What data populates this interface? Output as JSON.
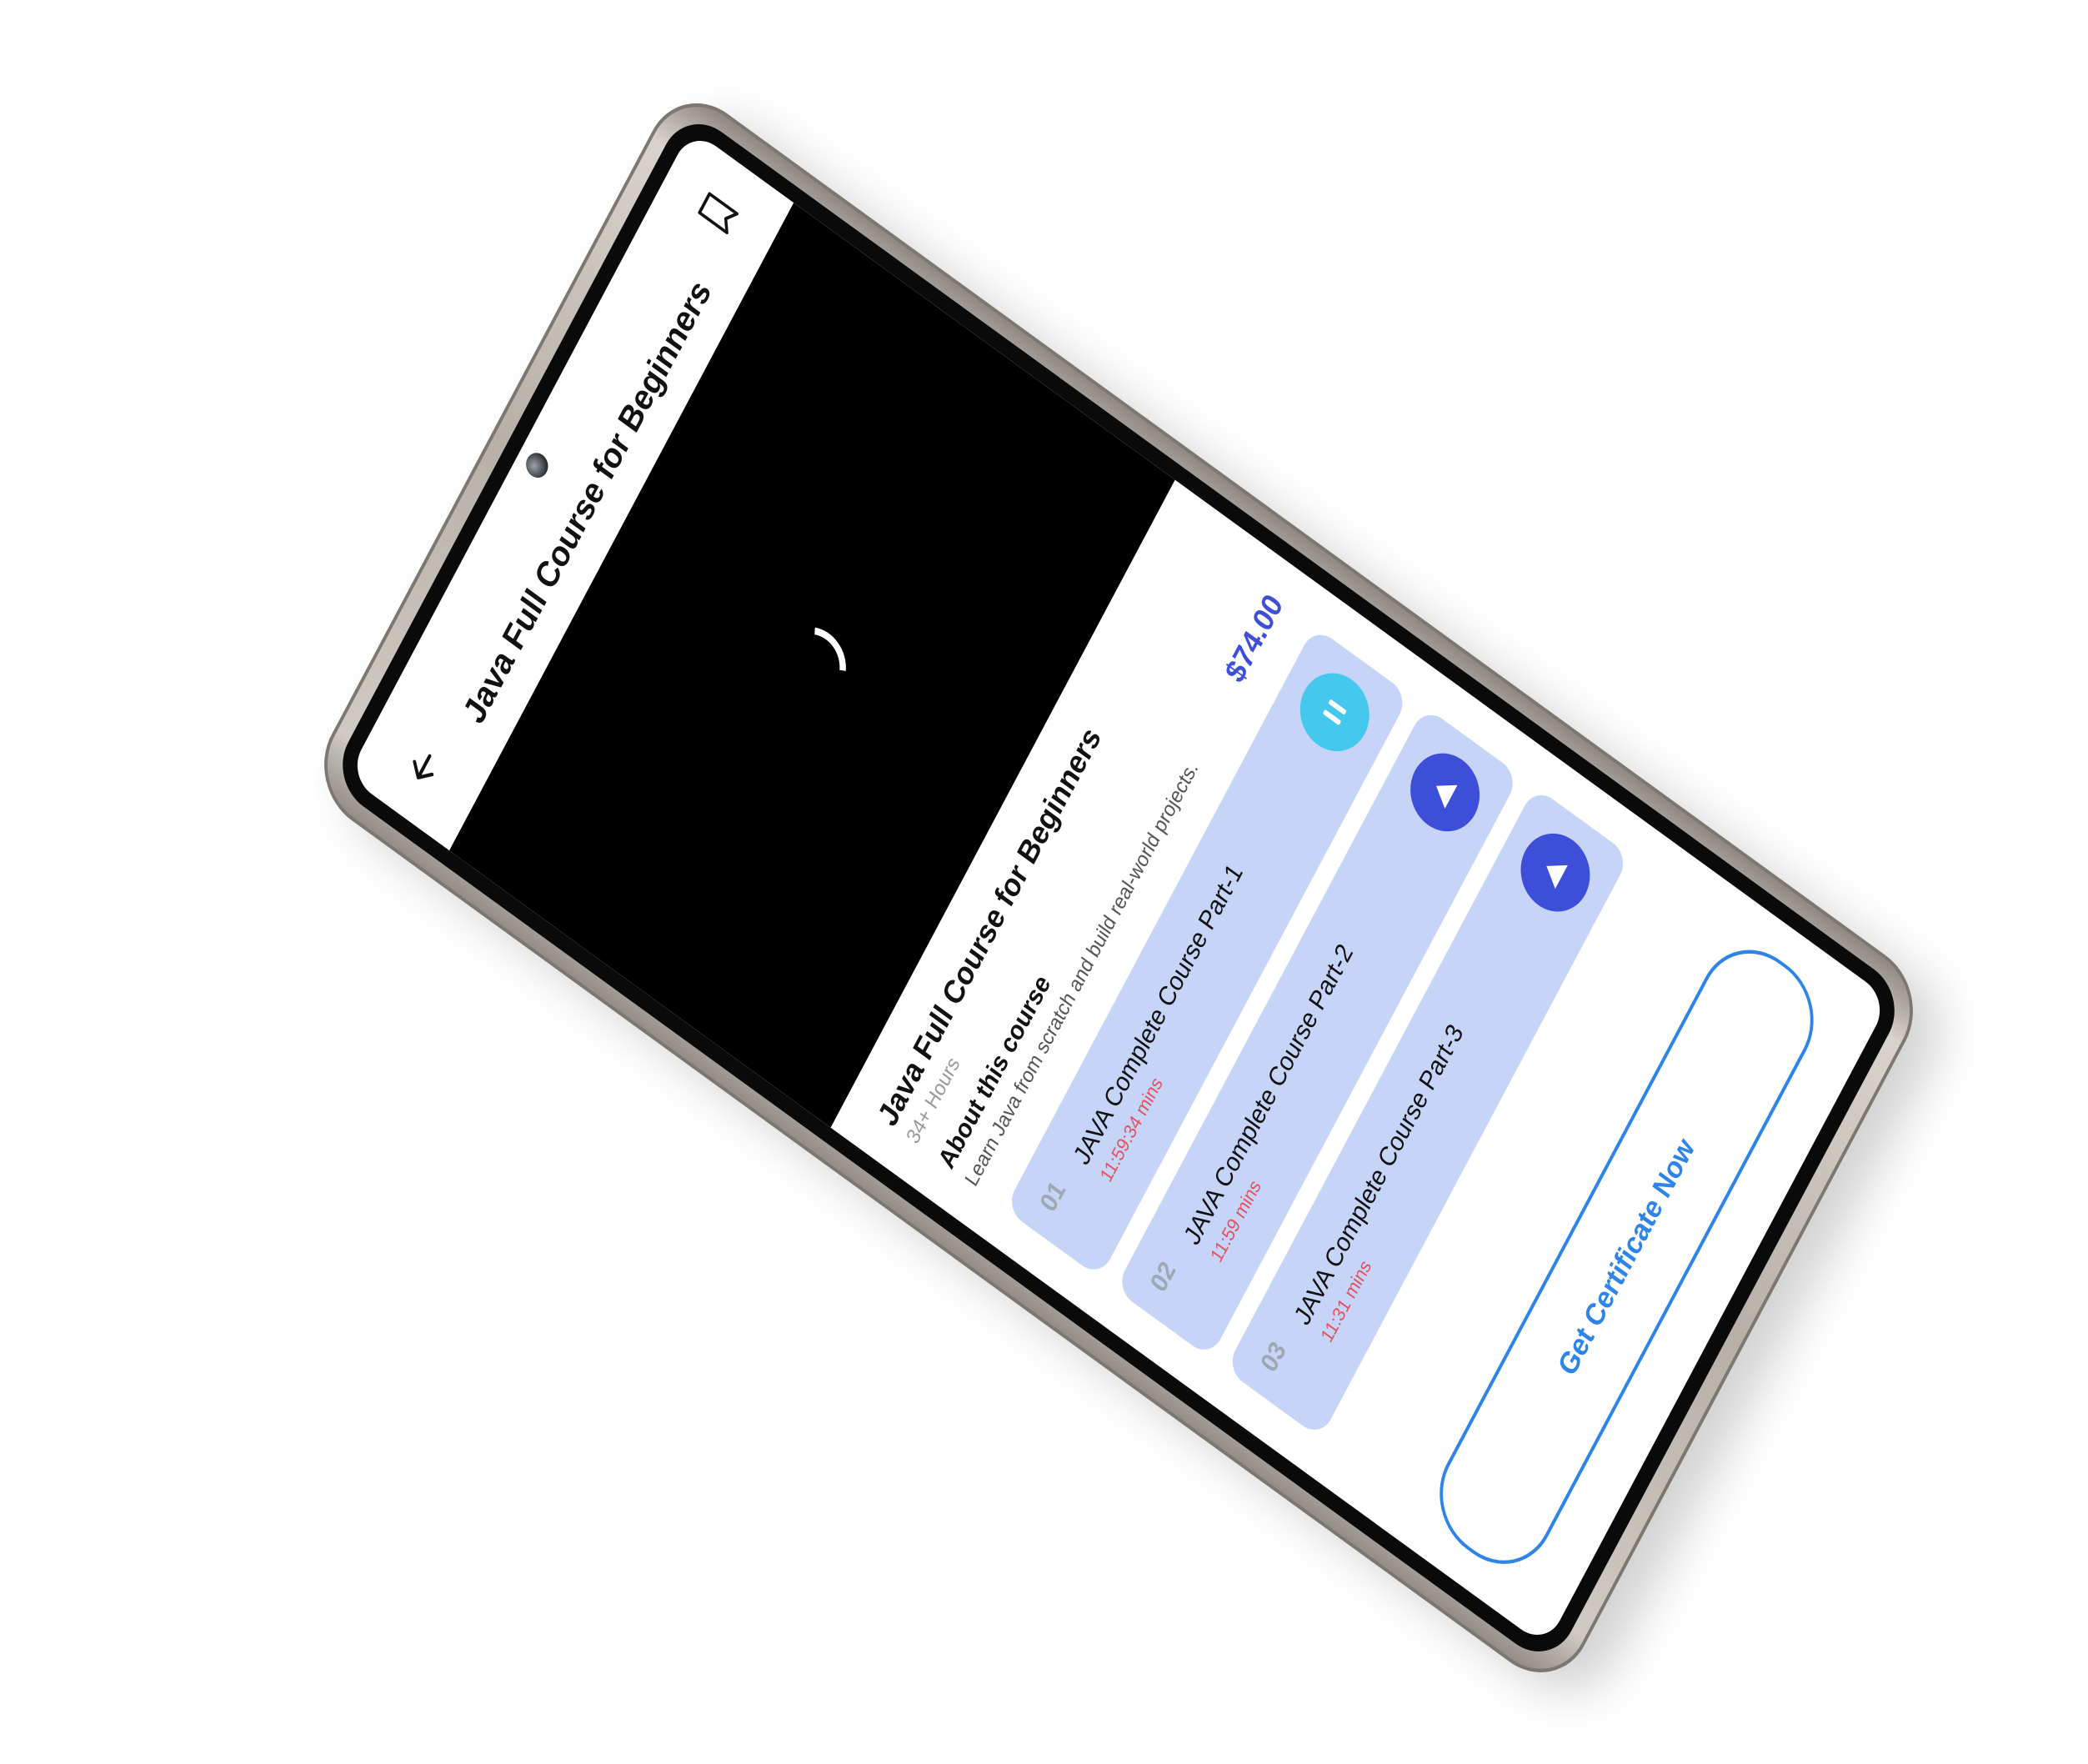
{
  "header": {
    "title": "Java Full Course for Beginners",
    "back_icon": "arrow-left-icon",
    "bookmark_icon": "bookmark-icon"
  },
  "video": {
    "state": "loading"
  },
  "course": {
    "title": "Java Full Course for Beginners",
    "duration": "34+ Hours",
    "about_heading": "About this course",
    "about_text": "Learn Java from scratch and build real-world projects.",
    "price": "$74.00"
  },
  "lessons": [
    {
      "number": "01",
      "title": "JAVA Complete Course Part-1",
      "time": "11:59:34 mins",
      "button": "pause-icon"
    },
    {
      "number": "02",
      "title": "JAVA Complete Course Part-2",
      "time": "11:59 mins",
      "button": "play-icon"
    },
    {
      "number": "03",
      "title": "JAVA Complete Course Part-3",
      "time": "11:31 mins",
      "button": "play-icon"
    }
  ],
  "cta": {
    "label": "Get Certificate Now"
  },
  "colors": {
    "accent": "#3f4fd8",
    "lesson_bg": "#c6d4f8",
    "time_red": "#e2525f",
    "pause_cyan": "#44c8ee",
    "cta_blue": "#2f84e8"
  }
}
